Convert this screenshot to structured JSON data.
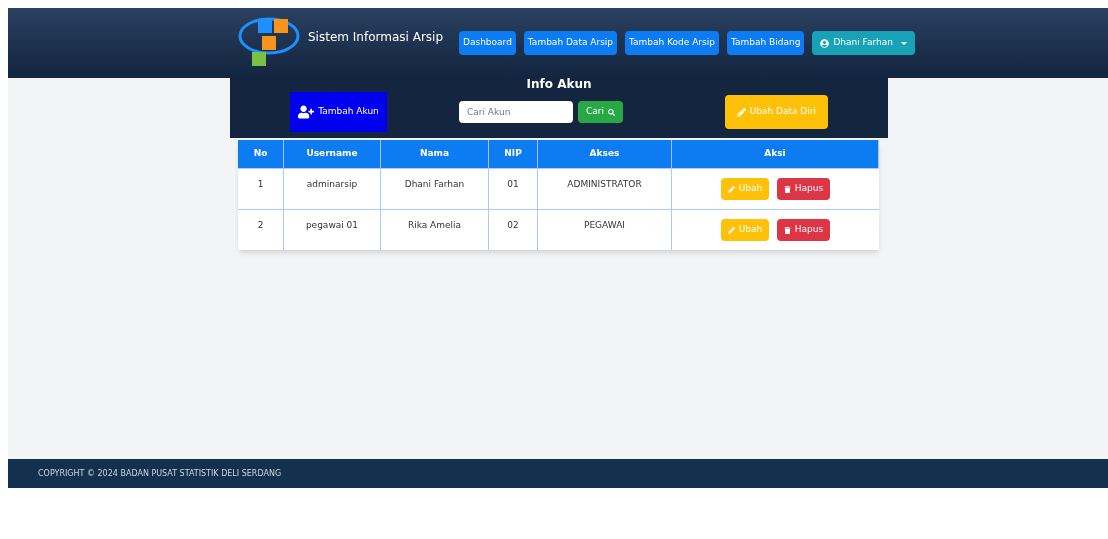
{
  "header": {
    "title": "Sistem Informasi Arsip",
    "nav": [
      {
        "label": "Dashboard",
        "kind": "link"
      },
      {
        "label": "Tambah Data Arsip",
        "kind": "link"
      },
      {
        "label": "Tambah Kode Arsip",
        "kind": "link"
      },
      {
        "label": "Tambah Bidang",
        "kind": "link"
      },
      {
        "label": "Dhani Farhan",
        "kind": "user"
      }
    ]
  },
  "panel": {
    "title": "Info Akun",
    "add_button": "Tambah Akun",
    "search": {
      "placeholder": "Cari Akun",
      "button": "Cari"
    },
    "edit_self_button": "Ubah Data Diri"
  },
  "table": {
    "columns": [
      "No",
      "Username",
      "Nama",
      "NIP",
      "Akses",
      "Aksi"
    ],
    "rows": [
      {
        "cells": [
          "1",
          "adminarsip",
          "Dhani Farhan",
          "01",
          "ADMINISTRATOR"
        ],
        "actions": [
          "Ubah",
          "Hapus"
        ]
      },
      {
        "cells": [
          "2",
          "pegawai 01",
          "Rika Amelia",
          "02",
          "PEGAWAI"
        ],
        "actions": [
          "Ubah",
          "Hapus"
        ]
      }
    ]
  },
  "footer": "COPYRIGHT © 2024 BADAN PUSAT STATISTIK DELI SERDANG"
}
